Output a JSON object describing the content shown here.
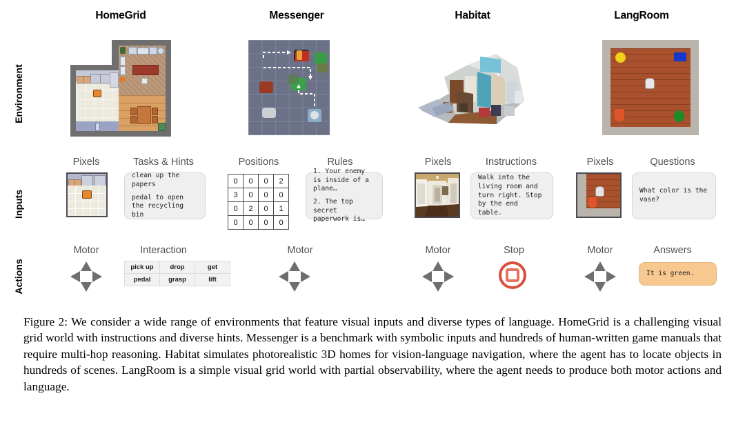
{
  "figure": {
    "row_labels": [
      "Environment",
      "Inputs",
      "Actions"
    ],
    "columns": [
      {
        "name": "HomeGrid",
        "title": "HomeGrid",
        "inputs": [
          {
            "label": "Pixels",
            "kind": "image"
          },
          {
            "label": "Tasks & Hints",
            "kind": "text",
            "lines": [
              "clean up the\npapers",
              "pedal to open the\nrecycling bin"
            ]
          }
        ],
        "actions": [
          {
            "label": "Motor",
            "kind": "dpad"
          },
          {
            "label": "Interaction",
            "kind": "table",
            "rows": [
              [
                "pick up",
                "drop",
                "get"
              ],
              [
                "pedal",
                "grasp",
                "lift"
              ]
            ]
          }
        ]
      },
      {
        "name": "Messenger",
        "title": "Messenger",
        "inputs": [
          {
            "label": "Positions",
            "kind": "matrix",
            "rows": [
              [
                "0",
                "0",
                "0",
                "2"
              ],
              [
                "3",
                "0",
                "0",
                "0"
              ],
              [
                "0",
                "2",
                "0",
                "1"
              ],
              [
                "0",
                "0",
                "0",
                "0"
              ]
            ]
          },
          {
            "label": "Rules",
            "kind": "text",
            "lines": [
              "1. Your enemy is\ninside of a\nplane…",
              "2. The top secret\npaperwork is…"
            ]
          }
        ],
        "actions": [
          {
            "label": "Motor",
            "kind": "dpad"
          }
        ]
      },
      {
        "name": "Habitat",
        "title": "Habitat",
        "inputs": [
          {
            "label": "Pixels",
            "kind": "image"
          },
          {
            "label": "Instructions",
            "kind": "text",
            "lines": [
              "Walk into the\nliving room and\nturn right. Stop\nby the end table."
            ]
          }
        ],
        "actions": [
          {
            "label": "Motor",
            "kind": "dpad"
          },
          {
            "label": "Stop",
            "kind": "stop-button"
          }
        ]
      },
      {
        "name": "LangRoom",
        "title": "LangRoom",
        "inputs": [
          {
            "label": "Pixels",
            "kind": "image"
          },
          {
            "label": "Questions",
            "kind": "text",
            "lines": [
              "What color is the\nvase?"
            ]
          }
        ],
        "actions": [
          {
            "label": "Motor",
            "kind": "dpad"
          },
          {
            "label": "Answers",
            "kind": "answer",
            "lines": [
              "It is green."
            ]
          }
        ]
      }
    ]
  },
  "labels": {
    "homegrid_title": "HomeGrid",
    "messenger_title": "Messenger",
    "habitat_title": "Habitat",
    "langroom_title": "LangRoom",
    "row_environment": "Environment",
    "row_inputs": "Inputs",
    "row_actions": "Actions",
    "hg_pixels": "Pixels",
    "hg_tasks": "Tasks & Hints",
    "msg_positions": "Positions",
    "msg_rules": "Rules",
    "hab_pixels": "Pixels",
    "hab_instructions": "Instructions",
    "lr_pixels": "Pixels",
    "lr_questions": "Questions",
    "hg_motor": "Motor",
    "hg_interaction": "Interaction",
    "msg_motor": "Motor",
    "hab_motor": "Motor",
    "hab_stop": "Stop",
    "lr_motor": "Motor",
    "lr_answers": "Answers"
  },
  "bubbles": {
    "hg_task_1": "clean up the papers",
    "hg_task_2": "pedal to open the recycling bin",
    "msg_rule_1": "1. Your enemy is inside of a plane…",
    "msg_rule_2": "2. The top secret paperwork is…",
    "hab_instruction": "Walk into the living room and turn right. Stop by the end table.",
    "lr_question": "What color is the vase?",
    "lr_answer": "It is green."
  },
  "positions_matrix": {
    "rows": [
      [
        "0",
        "0",
        "0",
        "2"
      ],
      [
        "3",
        "0",
        "0",
        "0"
      ],
      [
        "0",
        "2",
        "0",
        "1"
      ],
      [
        "0",
        "0",
        "0",
        "0"
      ]
    ]
  },
  "interaction_table": {
    "rows": [
      [
        "pick up",
        "drop",
        "get"
      ],
      [
        "pedal",
        "grasp",
        "lift"
      ]
    ]
  },
  "caption": {
    "text": "Figure 2: We consider a wide range of environments that feature visual inputs and diverse types of language. HomeGrid is a challenging visual grid world with instructions and diverse hints. Messenger is a benchmark with symbolic inputs and hundreds of human-written game manuals that require multi-hop reasoning.  Habitat simulates photorealistic 3D homes for vision-language navigation, where the agent has to locate objects in hundreds of scenes. LangRoom is a simple visual grid world with partial observability, where the agent needs to produce both motor actions and language."
  },
  "colors": {
    "stop_red": "#d9503f",
    "answer_orange": "#f7c991",
    "bubble_gray": "#efefef",
    "subtitle_gray": "#4d5156",
    "dpad_gray": "#6e6e6e"
  }
}
